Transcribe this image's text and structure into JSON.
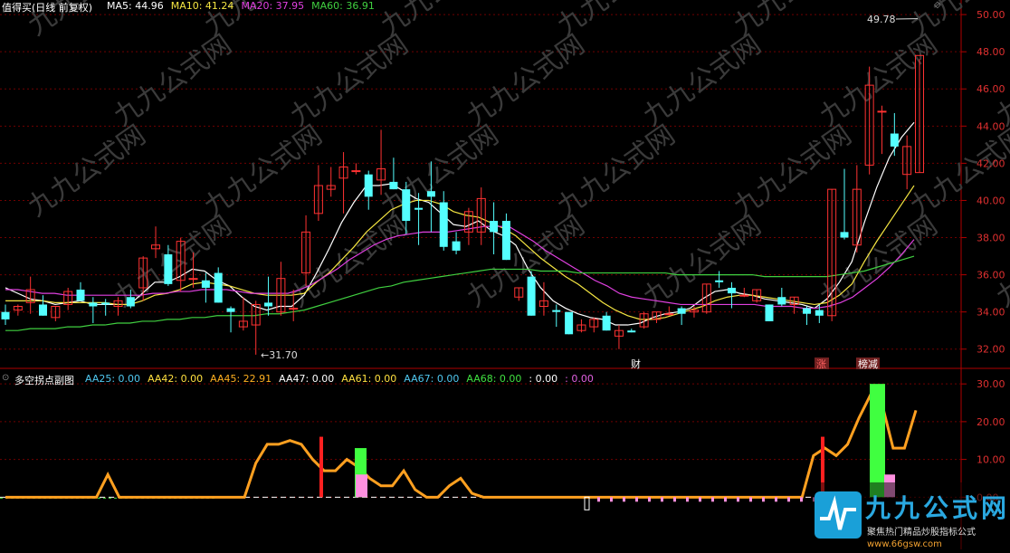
{
  "header": {
    "stock_title": "值得买(日线 前复权)",
    "ma_labels": [
      {
        "text": "MA5: 44.96",
        "color": "#ffffff"
      },
      {
        "text": "MA10: 41.24",
        "color": "#f5e642"
      },
      {
        "text": "MA20: 37.95",
        "color": "#e040e0"
      },
      {
        "text": "MA60: 36.91",
        "color": "#40d040"
      }
    ]
  },
  "sub_header": {
    "indicator_title": "多空拐点副图",
    "labels": [
      {
        "text": "AA25: 0.00",
        "color": "#50c8f0"
      },
      {
        "text": "AA42: 0.00",
        "color": "#ffe040"
      },
      {
        "text": "AA45: 22.91",
        "color": "#ffb020"
      },
      {
        "text": "AA47: 0.00",
        "color": "#ffffff"
      },
      {
        "text": "AA61: 0.00",
        "color": "#ffe040"
      },
      {
        "text": "AA67: 0.00",
        "color": "#50c8f0"
      },
      {
        "text": "AA68: 0.00",
        "color": "#40e040"
      },
      {
        "text": ": 0.00",
        "color": "#ffffff"
      },
      {
        "text": ": 0.00",
        "color": "#e060e0"
      }
    ]
  },
  "chart_data": [
    {
      "type": "candlestick",
      "title": "值得买(日线 前复权)",
      "ylim": [
        31.5,
        50.2
      ],
      "y_ticks": [
        "50.00",
        "48.00",
        "46.00",
        "44.00",
        "42.00",
        "40.00",
        "38.00",
        "36.00",
        "34.00",
        "32.00"
      ],
      "annotations": {
        "high": "49.78",
        "low": "31.70",
        "events": [
          "财",
          "涨",
          "榜减"
        ]
      },
      "candles": [
        {
          "o": 34.0,
          "h": 34.4,
          "l": 33.3,
          "c": 33.6
        },
        {
          "o": 34.1,
          "h": 34.4,
          "l": 33.8,
          "c": 34.3
        },
        {
          "o": 34.5,
          "h": 35.9,
          "l": 33.9,
          "c": 35.2
        },
        {
          "o": 34.4,
          "h": 34.9,
          "l": 33.8,
          "c": 33.8
        },
        {
          "o": 33.7,
          "h": 34.3,
          "l": 33.5,
          "c": 34.3
        },
        {
          "o": 34.4,
          "h": 35.3,
          "l": 34.1,
          "c": 35.1
        },
        {
          "o": 35.2,
          "h": 35.6,
          "l": 34.6,
          "c": 34.6
        },
        {
          "o": 34.5,
          "h": 34.8,
          "l": 33.4,
          "c": 34.3
        },
        {
          "o": 34.5,
          "h": 34.7,
          "l": 33.8,
          "c": 34.4
        },
        {
          "o": 34.3,
          "h": 34.8,
          "l": 33.8,
          "c": 34.6
        },
        {
          "o": 34.8,
          "h": 35.2,
          "l": 34.2,
          "c": 34.3
        },
        {
          "o": 35.3,
          "h": 37.0,
          "l": 34.6,
          "c": 36.9
        },
        {
          "o": 37.4,
          "h": 38.6,
          "l": 36.9,
          "c": 37.6
        },
        {
          "o": 37.1,
          "h": 37.6,
          "l": 35.4,
          "c": 35.5
        },
        {
          "o": 35.7,
          "h": 38.0,
          "l": 35.1,
          "c": 37.8
        },
        {
          "o": 35.8,
          "h": 37.2,
          "l": 35.3,
          "c": 35.8
        },
        {
          "o": 35.7,
          "h": 36.1,
          "l": 34.5,
          "c": 35.3
        },
        {
          "o": 36.1,
          "h": 36.4,
          "l": 34.5,
          "c": 34.5
        },
        {
          "o": 34.2,
          "h": 34.3,
          "l": 32.9,
          "c": 34.0
        },
        {
          "o": 33.2,
          "h": 34.8,
          "l": 33.0,
          "c": 33.5
        },
        {
          "o": 33.3,
          "h": 34.6,
          "l": 31.7,
          "c": 34.4
        },
        {
          "o": 34.5,
          "h": 35.9,
          "l": 33.8,
          "c": 34.3
        },
        {
          "o": 34.0,
          "h": 36.7,
          "l": 33.8,
          "c": 35.8
        },
        {
          "o": 34.2,
          "h": 35.2,
          "l": 33.5,
          "c": 34.2
        },
        {
          "o": 36.1,
          "h": 39.2,
          "l": 35.4,
          "c": 38.3
        },
        {
          "o": 39.3,
          "h": 41.9,
          "l": 38.9,
          "c": 40.8
        },
        {
          "o": 40.6,
          "h": 41.8,
          "l": 40.2,
          "c": 40.8
        },
        {
          "o": 41.2,
          "h": 42.6,
          "l": 39.3,
          "c": 41.8
        },
        {
          "o": 41.6,
          "h": 42.0,
          "l": 41.4,
          "c": 41.6
        },
        {
          "o": 41.4,
          "h": 41.6,
          "l": 39.5,
          "c": 40.2
        },
        {
          "o": 41.1,
          "h": 43.8,
          "l": 40.3,
          "c": 41.7
        },
        {
          "o": 41.0,
          "h": 42.3,
          "l": 40.6,
          "c": 40.6
        },
        {
          "o": 40.6,
          "h": 41.0,
          "l": 38.2,
          "c": 38.9
        },
        {
          "o": 39.6,
          "h": 40.4,
          "l": 37.6,
          "c": 39.5
        },
        {
          "o": 40.5,
          "h": 42.1,
          "l": 38.3,
          "c": 40.2
        },
        {
          "o": 39.9,
          "h": 40.5,
          "l": 37.3,
          "c": 37.5
        },
        {
          "o": 37.8,
          "h": 38.3,
          "l": 37.1,
          "c": 37.3
        },
        {
          "o": 38.3,
          "h": 39.6,
          "l": 37.6,
          "c": 39.4
        },
        {
          "o": 38.3,
          "h": 40.7,
          "l": 37.6,
          "c": 40.1
        },
        {
          "o": 38.9,
          "h": 39.9,
          "l": 37.1,
          "c": 38.3
        },
        {
          "o": 38.9,
          "h": 39.3,
          "l": 36.8,
          "c": 36.8
        },
        {
          "o": 34.8,
          "h": 35.3,
          "l": 34.6,
          "c": 35.3
        },
        {
          "o": 35.9,
          "h": 36.2,
          "l": 33.8,
          "c": 33.8
        },
        {
          "o": 34.3,
          "h": 35.6,
          "l": 33.8,
          "c": 34.6
        },
        {
          "o": 34.1,
          "h": 34.4,
          "l": 33.2,
          "c": 34.0
        },
        {
          "o": 34.0,
          "h": 34.0,
          "l": 32.8,
          "c": 32.8
        },
        {
          "o": 33.0,
          "h": 33.6,
          "l": 32.9,
          "c": 33.3
        },
        {
          "o": 33.2,
          "h": 33.7,
          "l": 32.9,
          "c": 33.6
        },
        {
          "o": 33.8,
          "h": 34.0,
          "l": 33.0,
          "c": 33.0
        },
        {
          "o": 32.7,
          "h": 33.3,
          "l": 32.0,
          "c": 33.0
        },
        {
          "o": 33.0,
          "h": 33.1,
          "l": 32.9,
          "c": 32.9
        },
        {
          "o": 33.2,
          "h": 34.0,
          "l": 33.1,
          "c": 33.9
        },
        {
          "o": 33.6,
          "h": 34.0,
          "l": 33.4,
          "c": 34.0
        },
        {
          "o": 33.9,
          "h": 34.3,
          "l": 33.8,
          "c": 33.9
        },
        {
          "o": 34.2,
          "h": 34.3,
          "l": 33.3,
          "c": 33.9
        },
        {
          "o": 34.0,
          "h": 34.3,
          "l": 33.7,
          "c": 34.1
        },
        {
          "o": 34.0,
          "h": 35.5,
          "l": 33.9,
          "c": 35.5
        },
        {
          "o": 35.7,
          "h": 36.2,
          "l": 35.3,
          "c": 35.6
        },
        {
          "o": 35.3,
          "h": 35.6,
          "l": 34.2,
          "c": 35.0
        },
        {
          "o": 34.9,
          "h": 35.3,
          "l": 34.8,
          "c": 34.9
        },
        {
          "o": 34.6,
          "h": 35.2,
          "l": 34.5,
          "c": 35.2
        },
        {
          "o": 34.4,
          "h": 34.4,
          "l": 33.5,
          "c": 33.5
        },
        {
          "o": 34.8,
          "h": 35.3,
          "l": 34.3,
          "c": 34.4
        },
        {
          "o": 34.4,
          "h": 34.8,
          "l": 33.9,
          "c": 34.8
        },
        {
          "o": 34.2,
          "h": 34.3,
          "l": 33.3,
          "c": 33.9
        },
        {
          "o": 34.1,
          "h": 34.4,
          "l": 33.4,
          "c": 33.8
        },
        {
          "o": 33.8,
          "h": 40.6,
          "l": 33.5,
          "c": 40.6
        },
        {
          "o": 38.3,
          "h": 41.7,
          "l": 37.9,
          "c": 38.0
        },
        {
          "o": 37.6,
          "h": 41.9,
          "l": 37.2,
          "c": 40.6
        },
        {
          "o": 41.9,
          "h": 47.2,
          "l": 41.4,
          "c": 46.2
        },
        {
          "o": 44.8,
          "h": 45.1,
          "l": 42.5,
          "c": 44.8
        },
        {
          "o": 43.6,
          "h": 44.7,
          "l": 42.4,
          "c": 42.9
        },
        {
          "o": 41.4,
          "h": 43.5,
          "l": 40.6,
          "c": 42.9
        },
        {
          "o": 41.5,
          "h": 47.6,
          "l": 41.5,
          "c": 47.8
        }
      ],
      "series": [
        {
          "name": "MA5",
          "color": "#ffffff",
          "values": [
            35.3,
            35.0,
            34.7,
            34.6,
            34.4,
            34.5,
            34.6,
            34.4,
            34.4,
            34.4,
            34.4,
            35.0,
            35.6,
            35.6,
            35.9,
            36.3,
            36.2,
            35.7,
            35.4,
            34.8,
            34.3,
            34.1,
            34.3,
            34.3,
            34.9,
            36.1,
            37.4,
            38.8,
            39.9,
            40.8,
            40.8,
            40.9,
            40.5,
            40.1,
            39.9,
            39.3,
            38.7,
            38.6,
            38.9,
            38.4,
            38.1,
            37.6,
            36.3,
            35.3,
            34.6,
            34.2,
            33.9,
            33.7,
            33.6,
            33.3,
            33.3,
            33.4,
            33.7,
            33.9,
            34.0,
            34.2,
            34.7,
            35.1,
            35.2,
            35.0,
            34.9,
            34.7,
            34.6,
            34.5,
            34.4,
            34.2,
            34.7,
            35.6,
            36.7,
            38.8,
            40.7,
            42.3,
            43.4,
            44.2
          ]
        },
        {
          "name": "MA10",
          "color": "#f5e642",
          "values": [
            34.6,
            34.6,
            34.6,
            34.6,
            34.5,
            34.5,
            34.5,
            34.5,
            34.5,
            34.4,
            34.4,
            34.6,
            34.9,
            35.0,
            35.2,
            35.5,
            35.6,
            35.5,
            35.4,
            35.2,
            35.0,
            34.9,
            34.9,
            34.9,
            35.0,
            35.6,
            36.1,
            36.8,
            37.5,
            38.3,
            38.9,
            39.5,
            39.8,
            40.0,
            40.0,
            39.8,
            39.4,
            39.2,
            39.1,
            38.8,
            38.5,
            38.1,
            37.5,
            36.9,
            36.4,
            35.9,
            35.5,
            35.0,
            34.5,
            34.1,
            33.8,
            33.6,
            33.6,
            33.7,
            33.9,
            34.1,
            34.3,
            34.6,
            34.8,
            34.9,
            34.9,
            34.8,
            34.7,
            34.6,
            34.5,
            34.4,
            34.5,
            34.9,
            35.5,
            36.7,
            37.8,
            38.8,
            39.8,
            40.8
          ]
        },
        {
          "name": "MA20",
          "color": "#e040e0",
          "values": [
            35.2,
            35.2,
            35.1,
            35.0,
            35.0,
            34.9,
            34.9,
            34.9,
            34.9,
            34.9,
            34.9,
            34.9,
            35.0,
            35.0,
            35.1,
            35.1,
            35.2,
            35.2,
            35.2,
            35.1,
            35.0,
            35.0,
            35.0,
            35.0,
            35.2,
            35.5,
            35.9,
            36.3,
            36.8,
            37.2,
            37.6,
            37.9,
            38.1,
            38.2,
            38.3,
            38.3,
            38.3,
            38.4,
            38.5,
            38.6,
            38.6,
            38.6,
            38.2,
            37.8,
            37.3,
            36.9,
            36.5,
            36.1,
            35.7,
            35.4,
            35.0,
            34.8,
            34.7,
            34.6,
            34.5,
            34.4,
            34.4,
            34.4,
            34.4,
            34.4,
            34.4,
            34.4,
            34.3,
            34.3,
            34.3,
            34.2,
            34.2,
            34.3,
            34.5,
            34.8,
            35.3,
            35.8,
            36.4,
            37.1,
            37.9
          ]
        },
        {
          "name": "MA60",
          "color": "#40d040",
          "values": [
            33.0,
            33.0,
            33.1,
            33.1,
            33.1,
            33.2,
            33.2,
            33.3,
            33.3,
            33.4,
            33.4,
            33.5,
            33.5,
            33.6,
            33.6,
            33.7,
            33.7,
            33.8,
            33.8,
            33.8,
            33.8,
            33.9,
            33.9,
            34.0,
            34.1,
            34.3,
            34.5,
            34.7,
            34.9,
            35.1,
            35.3,
            35.4,
            35.6,
            35.7,
            35.8,
            35.9,
            36.0,
            36.1,
            36.2,
            36.3,
            36.3,
            36.3,
            36.3,
            36.2,
            36.2,
            36.2,
            36.1,
            36.1,
            36.1,
            36.1,
            36.1,
            36.1,
            36.1,
            36.1,
            36.0,
            36.0,
            36.0,
            36.0,
            36.0,
            36.0,
            36.0,
            35.9,
            35.9,
            35.9,
            35.9,
            35.9,
            35.9,
            36.0,
            36.1,
            36.2,
            36.4,
            36.6,
            36.8,
            37.0
          ]
        }
      ]
    },
    {
      "type": "line",
      "title": "多空拐点副图",
      "ylim": [
        -4,
        31
      ],
      "y_ticks": [
        "30.00",
        "20.00",
        "10.00",
        "0.00"
      ],
      "series": [
        {
          "name": "AA45",
          "color": "#ffa020",
          "values": [
            0,
            0,
            0,
            2,
            0,
            0,
            0,
            2,
            0,
            0,
            0,
            0,
            0,
            0,
            0,
            0,
            0,
            0,
            0,
            0,
            0,
            0,
            0,
            0,
            0,
            0,
            0,
            0,
            0,
            0,
            0,
            0,
            0,
            0,
            0,
            0,
            0,
            0,
            0,
            0,
            0,
            0,
            0,
            0,
            0,
            0,
            0,
            0,
            0,
            0,
            0,
            0,
            0,
            0,
            0,
            0,
            0,
            0,
            0,
            0,
            0,
            0,
            0,
            0,
            0,
            0,
            0,
            0,
            0,
            0,
            0,
            0,
            0,
            0,
            0,
            0,
            0,
            0,
            0,
            0,
            0,
            0,
            0,
            0,
            0,
            0,
            0,
            0,
            0,
            0,
            0,
            0,
            0,
            0,
            0,
            0,
            0,
            0,
            0,
            0,
            0,
            0,
            0,
            0,
            0,
            0,
            0,
            0,
            0,
            0,
            0,
            0
          ]
        },
        {
          "name": "AA45-curve",
          "color": "#ffa020",
          "values": [
            0,
            0,
            0,
            0,
            0,
            0,
            0,
            0,
            0,
            6,
            0,
            0,
            0,
            0,
            0,
            0,
            0,
            0,
            0,
            0,
            0,
            0,
            9,
            14,
            14,
            15,
            14,
            10,
            7,
            7,
            10,
            8,
            5,
            3,
            3,
            7,
            2,
            0,
            0,
            3,
            5,
            1,
            0,
            0,
            0,
            0,
            0,
            0,
            0,
            0,
            0,
            0,
            0,
            0,
            0,
            0,
            0,
            0,
            0,
            0,
            0,
            0,
            0,
            0,
            0,
            0,
            0,
            0,
            0,
            0,
            0,
            11,
            13,
            11,
            14,
            21,
            27,
            25,
            13,
            13,
            23
          ]
        }
      ]
    }
  ]
}
